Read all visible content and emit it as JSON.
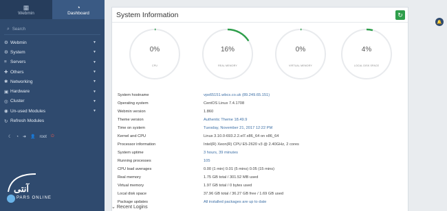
{
  "sidebar": {
    "tabs": [
      {
        "label": "Webmin",
        "icon": "webmin-icon",
        "glyph": "▦"
      },
      {
        "label": "Dashboard",
        "icon": "dashboard-icon",
        "glyph": "◔"
      }
    ],
    "search_placeholder": "Search",
    "items": [
      {
        "label": "Webmin",
        "glyph": "⚙"
      },
      {
        "label": "System",
        "glyph": "⚙"
      },
      {
        "label": "Servers",
        "glyph": "≡"
      },
      {
        "label": "Others",
        "glyph": "✚"
      },
      {
        "label": "Networking",
        "glyph": "✱"
      },
      {
        "label": "Hardware",
        "glyph": "▣"
      },
      {
        "label": "Cluster",
        "glyph": "◎"
      },
      {
        "label": "Un-used Modules",
        "glyph": "◉"
      },
      {
        "label": "Refresh Modules",
        "glyph": "↻"
      }
    ],
    "bottom_user": "root",
    "logo_text": "آنتی",
    "logo_sub": "PARS ONLINE"
  },
  "panel": {
    "title": "System Information",
    "gauges": [
      {
        "percent": 0,
        "label": "CPU"
      },
      {
        "percent": 16,
        "label": "REAL MEMORY"
      },
      {
        "percent": 0,
        "label": "VIRTUAL MEMORY"
      },
      {
        "percent": 4,
        "label": "LOCAL DISK SPACE"
      }
    ],
    "rows": [
      {
        "key": "System hostname",
        "value": "vps65151.wbcs.co.uk (89.249.65.151)",
        "link": true
      },
      {
        "key": "Operating system",
        "value": "CentOS Linux 7.4.1708",
        "link": false
      },
      {
        "key": "Webmin version",
        "value": "1.860",
        "link": false
      },
      {
        "key": "Theme version",
        "value": "Authentic Theme 18.49.9",
        "link": true
      },
      {
        "key": "Time on system",
        "value": "Tuesday, November 21, 2017 12:22 PM",
        "link": true
      },
      {
        "key": "Kernel and CPU",
        "value": "Linux 3.10.0-693.2.2.el7.x86_64 on x86_64",
        "link": false
      },
      {
        "key": "Processor information",
        "value": "Intel(R) Xeon(R) CPU E5-2620 v3 @ 2.40GHz, 2 cores",
        "link": false
      },
      {
        "key": "System uptime",
        "value": "3 hours, 39 minutes",
        "link": true
      },
      {
        "key": "Running processes",
        "value": "105",
        "link": true
      },
      {
        "key": "CPU load averages",
        "value": "0.00 (1 min) 0.01 (5 mins) 0.05 (15 mins)",
        "link": false
      },
      {
        "key": "Real memory",
        "value": "1.75 GB total / 301.52 MB used",
        "link": false
      },
      {
        "key": "Virtual memory",
        "value": "1.97 GB total / 0 bytes used",
        "link": false
      },
      {
        "key": "Local disk space",
        "value": "37.96 GB total / 36.27 GB free / 1.69 GB used",
        "link": false
      },
      {
        "key": "Package updates",
        "value": "All installed packages are up to date",
        "link": true
      }
    ],
    "recent_label": "Recent Logins"
  },
  "colors": {
    "sidebar": "#2f4a6e",
    "accent": "#2e9e4b",
    "link": "#3b6ea5"
  }
}
